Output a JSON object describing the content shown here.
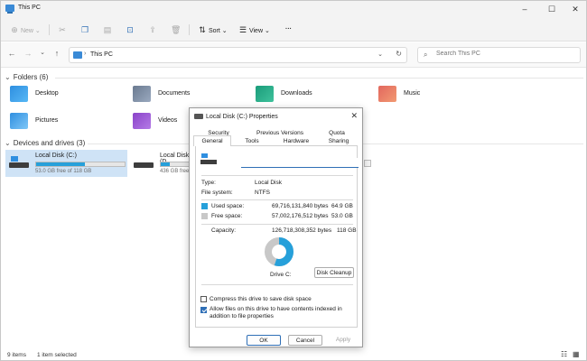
{
  "window": {
    "title": "This PC"
  },
  "toolbar": {
    "new_label": "New",
    "sort_label": "Sort",
    "view_label": "View",
    "more_label": "···"
  },
  "address": {
    "path": "This PC"
  },
  "search": {
    "placeholder": "Search This PC"
  },
  "folders": {
    "header": "Folders (6)",
    "items": [
      {
        "label": "Desktop"
      },
      {
        "label": "Documents"
      },
      {
        "label": "Downloads"
      },
      {
        "label": "Music"
      },
      {
        "label": "Pictures"
      },
      {
        "label": "Videos"
      }
    ]
  },
  "drives": {
    "header": "Devices and drives (3)",
    "items": [
      {
        "name": "Local Disk (C:)",
        "free": "53.0 GB free of 118 GB",
        "used_fraction": 0.55
      },
      {
        "name": "Local Disk (D",
        "free": "436 GB free",
        "used_fraction": 0.1
      }
    ]
  },
  "status": {
    "count": "9 items",
    "selected": "1 item selected"
  },
  "dialog": {
    "title": "Local Disk (C:) Properties",
    "tabs_row1": [
      "Security",
      "Previous Versions",
      "Quota"
    ],
    "tabs_row2": [
      "General",
      "Tools",
      "Hardware",
      "Sharing"
    ],
    "type_label": "Type:",
    "type_value": "Local Disk",
    "fs_label": "File system:",
    "fs_value": "NTFS",
    "used_label": "Used space:",
    "used_bytes": "69,716,131,840 bytes",
    "used_gb": "64.9 GB",
    "free_label": "Free space:",
    "free_bytes": "57,002,176,512 bytes",
    "free_gb": "53.0 GB",
    "capacity_label": "Capacity:",
    "capacity_bytes": "126,718,308,352 bytes",
    "capacity_gb": "118 GB",
    "drive_label": "Drive C:",
    "cleanup_label": "Disk Cleanup",
    "compress_label": "Compress this drive to save disk space",
    "index_label": "Allow files on this drive to have contents indexed in addition to file properties",
    "ok_label": "OK",
    "cancel_label": "Cancel",
    "apply_label": "Apply",
    "used_fraction": 0.55
  },
  "colors": {
    "used": "#26a0da",
    "free": "#c8c8c8",
    "accent": "#2f6fb6"
  }
}
